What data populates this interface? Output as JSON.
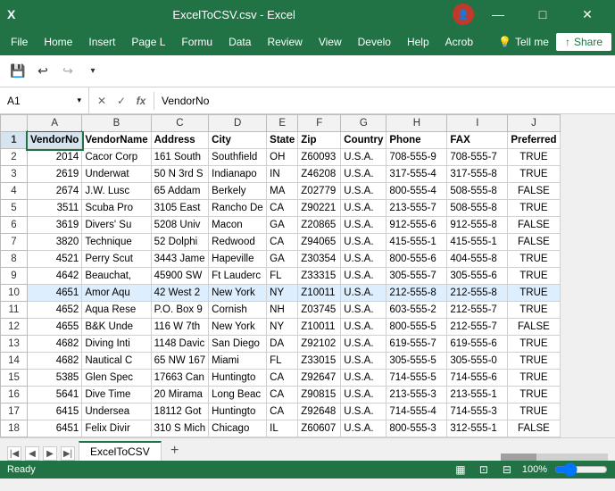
{
  "titleBar": {
    "title": "ExcelToCSV.csv - Excel",
    "minimize": "—",
    "maximize": "□",
    "close": "✕"
  },
  "menuBar": {
    "items": [
      "File",
      "Home",
      "Insert",
      "Page L",
      "Formu",
      "Data",
      "Review",
      "View",
      "Develo",
      "Help",
      "Acrob"
    ],
    "tellMe": "Tell me",
    "share": "Share"
  },
  "toolbar": {
    "save": "💾",
    "undo": "↩",
    "redo": "↪"
  },
  "formulaBar": {
    "nameBox": "A1",
    "formula": "VendorNo"
  },
  "columns": [
    "",
    "A",
    "B",
    "C",
    "D",
    "E",
    "F",
    "G",
    "H",
    "I",
    "J"
  ],
  "headers": [
    "VendorNo",
    "VendorName",
    "Address",
    "City",
    "State",
    "Zip",
    "Country",
    "Phone",
    "FAX",
    "Preferred"
  ],
  "rows": [
    {
      "num": 1,
      "data": [
        "VendorNo",
        "VendorName",
        "Address",
        "City",
        "State",
        "Zip",
        "Country",
        "Phone",
        "FAX",
        "Preferred"
      ],
      "isHeader": true
    },
    {
      "num": 2,
      "data": [
        "2014",
        "Cacor Corp",
        "161 South",
        "Southfield",
        "OH",
        "Z60093",
        "U.S.A.",
        "708-555-9",
        "708-555-7",
        "TRUE"
      ]
    },
    {
      "num": 3,
      "data": [
        "2619",
        "Underwat",
        "50 N 3rd S",
        "Indianapo",
        "IN",
        "Z46208",
        "U.S.A.",
        "317-555-4",
        "317-555-8",
        "TRUE"
      ]
    },
    {
      "num": 4,
      "data": [
        "2674",
        "J.W. Lusc",
        "65 Addam",
        "Berkely",
        "MA",
        "Z02779",
        "U.S.A.",
        "800-555-4",
        "508-555-8",
        "FALSE"
      ]
    },
    {
      "num": 5,
      "data": [
        "3511",
        "Scuba Pro",
        "3105 East",
        "Rancho De",
        "CA",
        "Z90221",
        "U.S.A.",
        "213-555-7",
        "508-555-8",
        "TRUE"
      ]
    },
    {
      "num": 6,
      "data": [
        "3619",
        "Divers' Su",
        "5208 Univ",
        "Macon",
        "GA",
        "Z20865",
        "U.S.A.",
        "912-555-6",
        "912-555-8",
        "FALSE"
      ]
    },
    {
      "num": 7,
      "data": [
        "3820",
        "Technique",
        "52 Dolphi",
        "Redwood",
        "CA",
        "Z94065",
        "U.S.A.",
        "415-555-1",
        "415-555-1",
        "FALSE"
      ]
    },
    {
      "num": 8,
      "data": [
        "4521",
        "Perry Scut",
        "3443 Jame",
        "Hapeville",
        "GA",
        "Z30354",
        "U.S.A.",
        "800-555-6",
        "404-555-8",
        "TRUE"
      ]
    },
    {
      "num": 9,
      "data": [
        "4642",
        "Beauchat,",
        "45900 SW",
        "Ft Lauderc",
        "FL",
        "Z33315",
        "U.S.A.",
        "305-555-7",
        "305-555-6",
        "TRUE"
      ]
    },
    {
      "num": 10,
      "data": [
        "4651",
        "Amor Aqu",
        "42 West 2",
        "New York",
        "NY",
        "Z10011",
        "U.S.A.",
        "212-555-8",
        "212-555-8",
        "TRUE"
      ]
    },
    {
      "num": 11,
      "data": [
        "4652",
        "Aqua Rese",
        "P.O. Box 9",
        "Cornish",
        "NH",
        "Z03745",
        "U.S.A.",
        "603-555-2",
        "212-555-7",
        "TRUE"
      ]
    },
    {
      "num": 12,
      "data": [
        "4655",
        "B&K Unde",
        "116 W 7th",
        "New York",
        "NY",
        "Z10011",
        "U.S.A.",
        "800-555-5",
        "212-555-7",
        "FALSE"
      ]
    },
    {
      "num": 13,
      "data": [
        "4682",
        "Diving Inti",
        "1148 Davic",
        "San Diego",
        "DA",
        "Z92102",
        "U.S.A.",
        "619-555-7",
        "619-555-6",
        "TRUE"
      ]
    },
    {
      "num": 14,
      "data": [
        "4682",
        "Nautical C",
        "65 NW 167",
        "Miami",
        "FL",
        "Z33015",
        "U.S.A.",
        "305-555-5",
        "305-555-0",
        "TRUE"
      ]
    },
    {
      "num": 15,
      "data": [
        "5385",
        "Glen Spec",
        "17663 Can",
        "Huntingto",
        "CA",
        "Z92647",
        "U.S.A.",
        "714-555-5",
        "714-555-6",
        "TRUE"
      ]
    },
    {
      "num": 16,
      "data": [
        "5641",
        "Dive Time",
        "20 Mirama",
        "Long Beac",
        "CA",
        "Z90815",
        "U.S.A.",
        "213-555-3",
        "213-555-1",
        "TRUE"
      ]
    },
    {
      "num": 17,
      "data": [
        "6415",
        "Undersea",
        "18112 Got",
        "Huntingto",
        "CA",
        "Z92648",
        "U.S.A.",
        "714-555-4",
        "714-555-3",
        "TRUE"
      ]
    },
    {
      "num": 18,
      "data": [
        "6451",
        "Felix Divir",
        "310 S Mich",
        "Chicago",
        "IL",
        "Z60607",
        "U.S.A.",
        "800-555-3",
        "312-555-1",
        "FALSE"
      ]
    }
  ],
  "sheet": {
    "activeTab": "ExcelToCSV",
    "tabs": [
      "ExcelToCSV"
    ]
  },
  "statusBar": {
    "ready": "Ready"
  }
}
